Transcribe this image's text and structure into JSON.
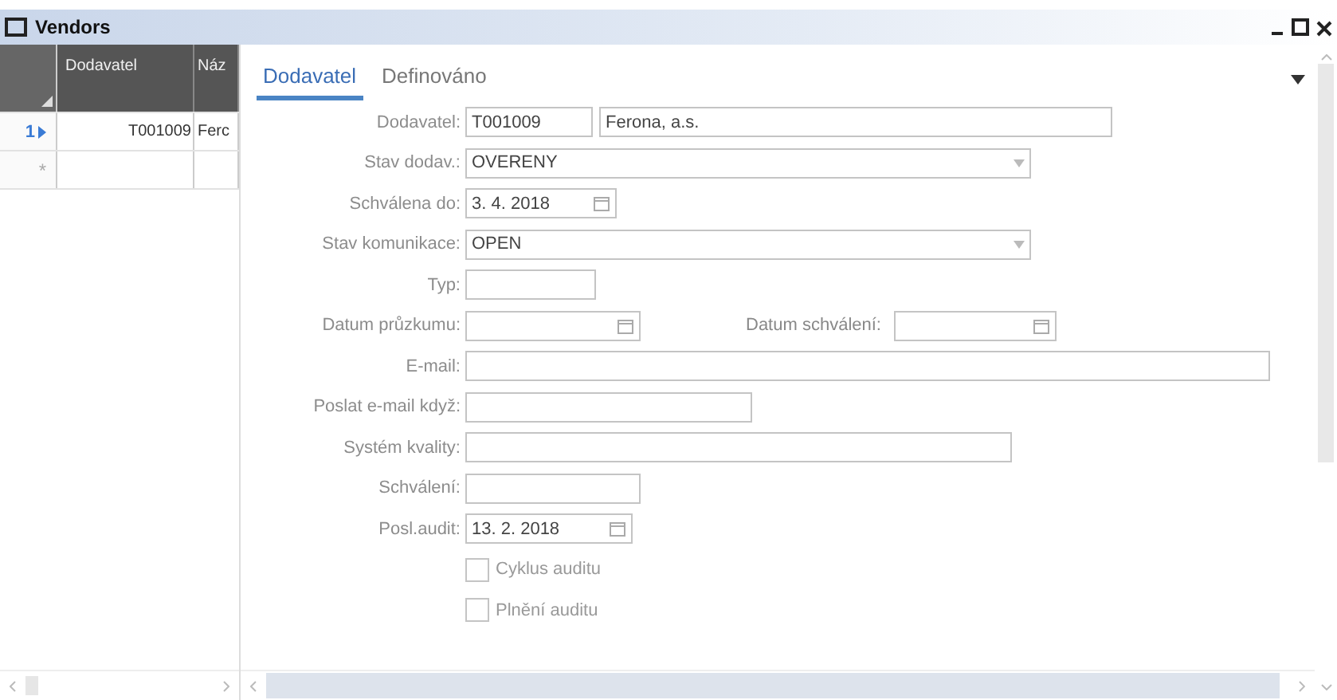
{
  "window": {
    "title": "Vendors"
  },
  "grid": {
    "columns": [
      "Dodavatel",
      "Náz"
    ],
    "rows": [
      {
        "marker": "1",
        "current": true,
        "cells": [
          "T001009",
          "Ferc"
        ]
      },
      {
        "marker": "*",
        "current": false,
        "cells": [
          "",
          ""
        ]
      }
    ]
  },
  "tabs": [
    {
      "label": "Dodavatel",
      "selected": true
    },
    {
      "label": "Definováno",
      "selected": false
    }
  ],
  "form": [
    {
      "label": "Dodavatel:",
      "inputs": [
        {
          "kind": "text",
          "value": "T001009"
        },
        {
          "kind": "text",
          "value": "Ferona, a.s."
        }
      ]
    },
    {
      "label": "Stav dodav.:",
      "inputs": [
        {
          "kind": "dropdown",
          "value": "OVERENY"
        }
      ]
    },
    {
      "label": "Schválena do:",
      "inputs": [
        {
          "kind": "date",
          "value": "3. 4. 2018"
        }
      ]
    },
    {
      "label": "Stav komunikace:",
      "inputs": [
        {
          "kind": "dropdown",
          "value": "OPEN"
        }
      ]
    },
    {
      "label": "Typ:",
      "inputs": [
        {
          "kind": "text"
        }
      ]
    },
    {
      "label": "Datum průzkumu:",
      "inputs": [
        {
          "kind": "date"
        },
        {
          "kind": "label",
          "value": "Datum schválení:"
        },
        {
          "kind": "date"
        }
      ]
    },
    {
      "label": "E-mail:",
      "inputs": [
        {
          "kind": "text"
        }
      ]
    },
    {
      "label": "Poslat e-mail když:",
      "inputs": [
        {
          "kind": "text"
        }
      ]
    },
    {
      "label": "Systém kvality:",
      "inputs": [
        {
          "kind": "text"
        }
      ]
    },
    {
      "label": "Schválení:",
      "inputs": [
        {
          "kind": "text"
        }
      ]
    },
    {
      "label": "Posl.audit:",
      "inputs": [
        {
          "kind": "date",
          "value": "13. 2. 2018"
        }
      ]
    },
    {
      "inputs": [
        {
          "kind": "checkbox",
          "value": "Cyklus auditu",
          "checked": false
        }
      ]
    },
    {
      "inputs": [
        {
          "kind": "checkbox",
          "value": "Plnění auditu",
          "checked": false
        }
      ]
    }
  ]
}
